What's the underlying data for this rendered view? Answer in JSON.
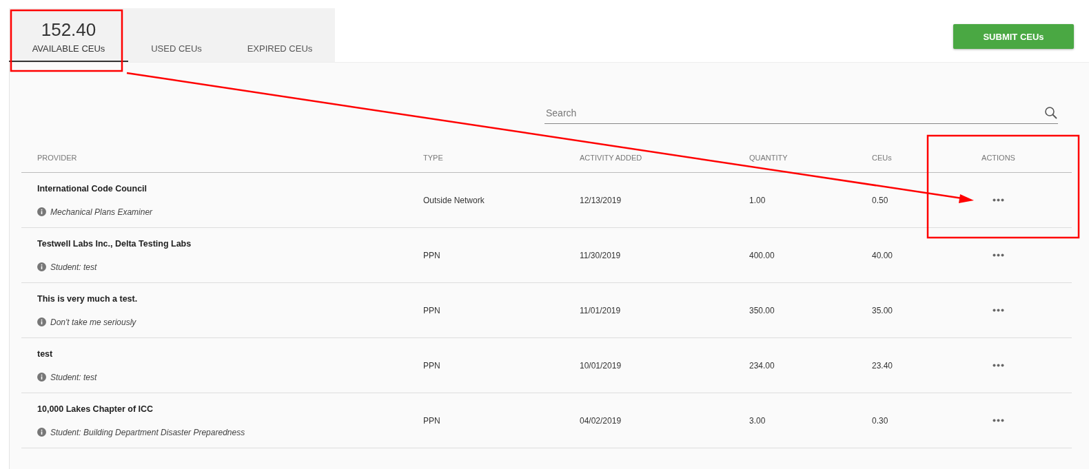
{
  "tabs": [
    {
      "value": "152.40",
      "label": "AVAILABLE CEUs",
      "selected": true
    },
    {
      "label": "USED CEUs",
      "selected": false
    },
    {
      "label": "EXPIRED CEUs",
      "selected": false
    }
  ],
  "submit_button": "SUBMIT CEUs",
  "search": {
    "placeholder": "Search"
  },
  "table": {
    "columns": [
      "PROVIDER",
      "TYPE",
      "ACTIVITY ADDED",
      "QUANTITY",
      "CEUs",
      "ACTIONS"
    ],
    "rows": [
      {
        "provider": "International Code Council",
        "note": "Mechanical Plans Examiner",
        "type": "Outside Network",
        "added": "12/13/2019",
        "quantity": "1.00",
        "ceus": "0.50"
      },
      {
        "provider": "Testwell Labs Inc., Delta Testing Labs",
        "note": "Student: test",
        "type": "PPN",
        "added": "11/30/2019",
        "quantity": "400.00",
        "ceus": "40.00"
      },
      {
        "provider": "This is very much a test.",
        "note": "Don't take me seriously",
        "type": "PPN",
        "added": "11/01/2019",
        "quantity": "350.00",
        "ceus": "35.00"
      },
      {
        "provider": "test",
        "note": "Student: test",
        "type": "PPN",
        "added": "10/01/2019",
        "quantity": "234.00",
        "ceus": "23.40"
      },
      {
        "provider": "10,000 Lakes Chapter of ICC",
        "note": "Student: Building Department Disaster Preparedness",
        "type": "PPN",
        "added": "04/02/2019",
        "quantity": "3.00",
        "ceus": "0.30"
      }
    ]
  }
}
